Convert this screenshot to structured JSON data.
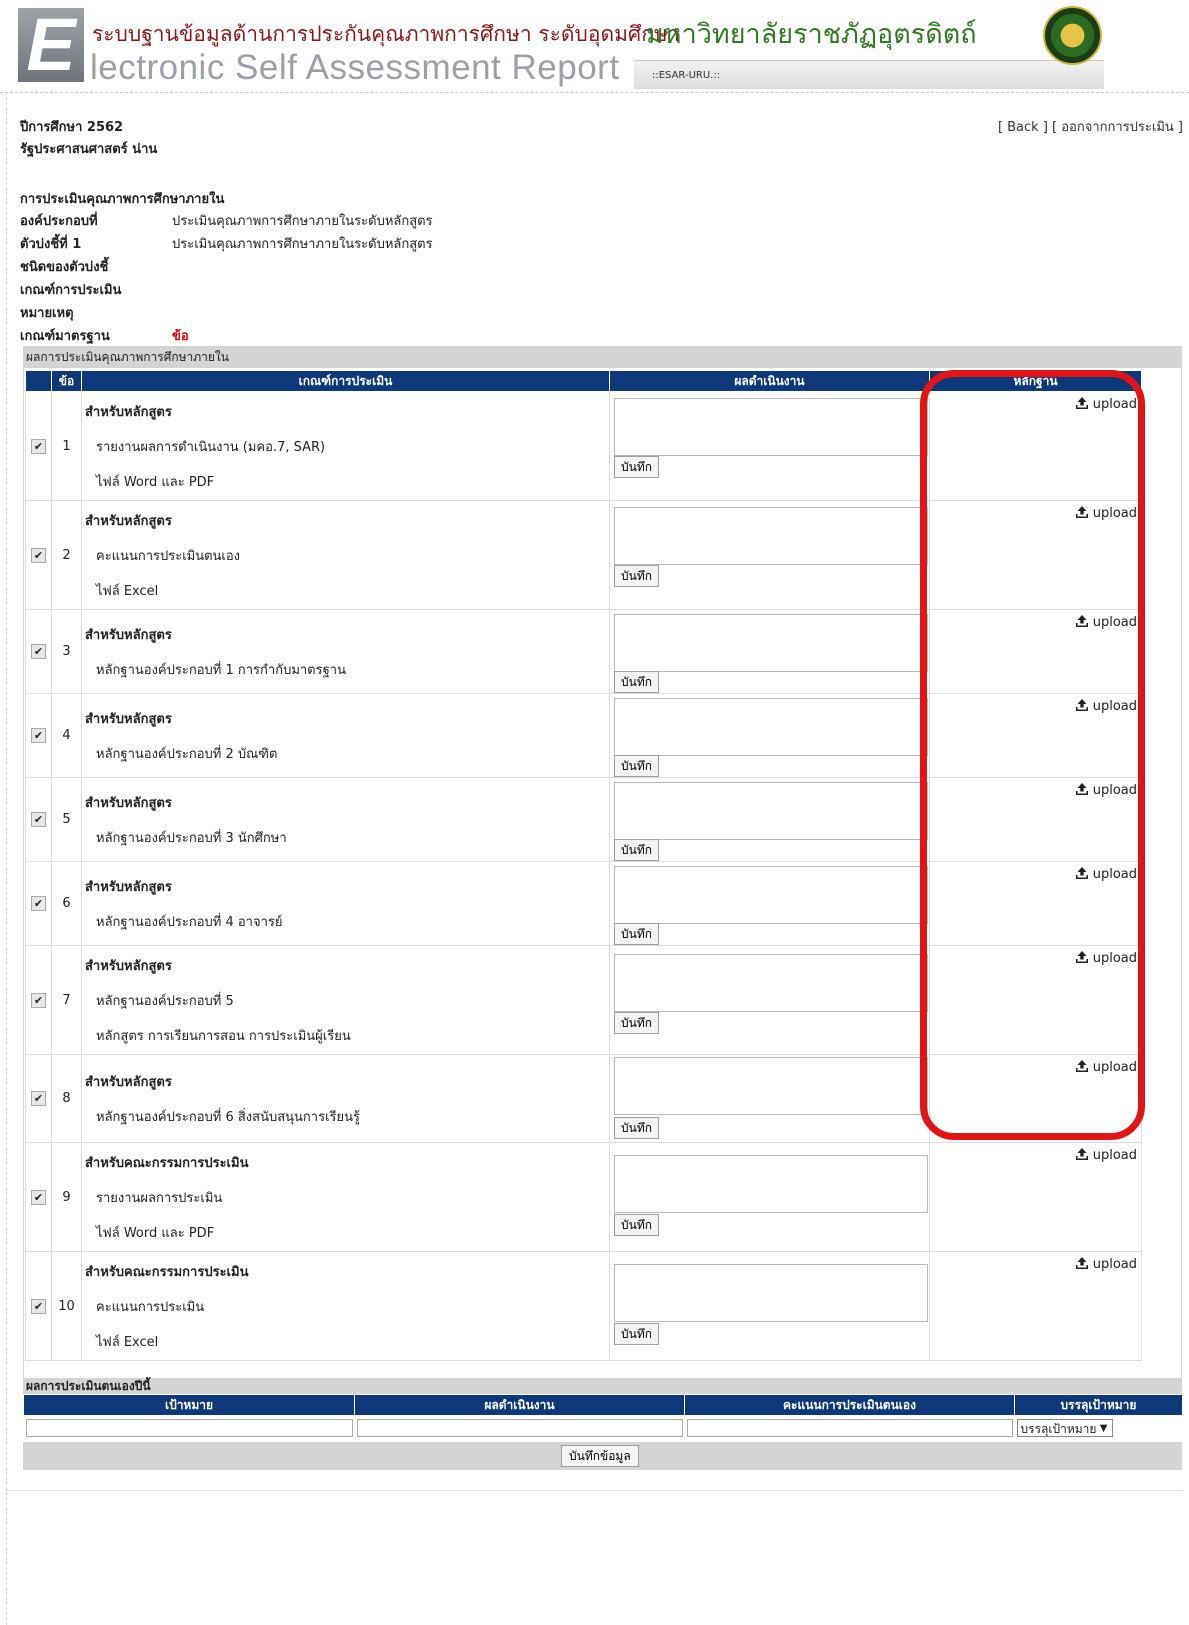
{
  "header": {
    "thai_title": "ระบบฐานข้อมูลด้านการประกันคุณภาพการศึกษา ระดับอุดมศึกษา",
    "en_title": "lectronic Self Assessment Report",
    "logo_letter": "E",
    "tab_text": "::ESAR-URU.::",
    "university": "มหาวิทยาลัยราชภัฏอุตรดิตถ์"
  },
  "page": {
    "year_label": "ปีการศึกษา 2562",
    "program": "รัฐประศาสนศาสตร์ น่าน",
    "back_link": "[ Back ]",
    "logout_link": "[ ออกจากการประเมิน ]"
  },
  "info": {
    "heading": "การประเมินคุณภาพการศึกษาภายใน",
    "rows": [
      {
        "label": "องค์ประกอบที่",
        "value": "ประเมินคุณภาพการศึกษาภายในระดับหลักสูตร"
      },
      {
        "label": "ตัวบ่งชี้ที่ 1",
        "value": "ประเมินคุณภาพการศึกษาภายในระดับหลักสูตร"
      },
      {
        "label": "ชนิดของตัวบ่งชี้",
        "value": ""
      },
      {
        "label": "เกณฑ์การประเมิน",
        "value": ""
      },
      {
        "label": "หมายเหตุ",
        "value": ""
      },
      {
        "label": "เกณฑ์มาตรฐาน",
        "value": "ข้อ"
      }
    ]
  },
  "grid": {
    "panel_title": "ผลการประเมินคุณภาพการศึกษาภายใน",
    "columns": [
      "",
      "ข้อ",
      "เกณฑ์การประเมิน",
      "ผลดำเนินงาน",
      "หลักฐาน"
    ],
    "save_label": "บันทึก",
    "upload_label": "upload",
    "rows": [
      {
        "no": "1",
        "checked": true,
        "head": "สำหรับหลักสูตร",
        "lines": [
          "รายงานผลการดำเนินงาน (มคอ.7, SAR)",
          "ไฟล์ Word และ PDF"
        ]
      },
      {
        "no": "2",
        "checked": true,
        "head": "สำหรับหลักสูตร",
        "lines": [
          "คะแนนการประเมินตนเอง",
          "ไฟล์ Excel"
        ]
      },
      {
        "no": "3",
        "checked": true,
        "head": "สำหรับหลักสูตร",
        "lines": [
          "หลักฐานองค์ประกอบที่ 1 การกำกับมาตรฐาน"
        ]
      },
      {
        "no": "4",
        "checked": true,
        "head": "สำหรับหลักสูตร",
        "lines": [
          "หลักฐานองค์ประกอบที่ 2 บัณฑิต"
        ]
      },
      {
        "no": "5",
        "checked": true,
        "head": "สำหรับหลักสูตร",
        "lines": [
          "หลักฐานองค์ประกอบที่ 3 นักศึกษา"
        ]
      },
      {
        "no": "6",
        "checked": true,
        "head": "สำหรับหลักสูตร",
        "lines": [
          "หลักฐานองค์ประกอบที่ 4 อาจารย์"
        ]
      },
      {
        "no": "7",
        "checked": true,
        "head": "สำหรับหลักสูตร",
        "lines": [
          "หลักฐานองค์ประกอบที่ 5",
          "หลักสูตร การเรียนการสอน การประเมินผู้เรียน"
        ]
      },
      {
        "no": "8",
        "checked": true,
        "head": "สำหรับหลักสูตร",
        "lines": [
          "หลักฐานองค์ประกอบที่ 6 สิ่งสนับสนุนการเรียนรู้"
        ]
      },
      {
        "no": "9",
        "checked": true,
        "head": "สำหรับคณะกรรมการประเมิน",
        "lines": [
          "รายงานผลการประเมิน",
          "ไฟล์ Word และ PDF"
        ]
      },
      {
        "no": "10",
        "checked": true,
        "head": "สำหรับคณะกรรมการประเมิน",
        "lines": [
          "คะแนนการประเมิน",
          "ไฟล์ Excel"
        ]
      }
    ]
  },
  "self_assessment": {
    "title": "ผลการประเมินตนเองปีนี้",
    "columns": [
      "เป้าหมาย",
      "ผลดำเนินงาน",
      "คะแนนการประเมินตนเอง",
      "บรรลุเป้าหมาย"
    ],
    "select_value": "บรรลุเป้าหมาย",
    "save_all_label": "บันทึกข้อมูล"
  },
  "highlight_color": "#e21414",
  "header_bar_color": "#0d3879"
}
